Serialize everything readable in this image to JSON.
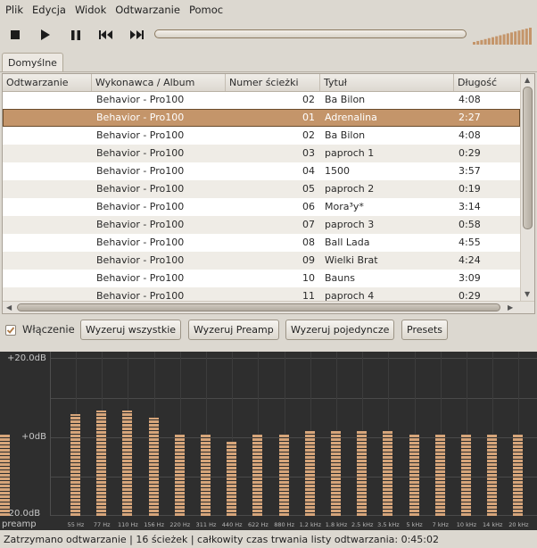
{
  "menu": [
    "Plik",
    "Edycja",
    "Widok",
    "Odtwarzanie",
    "Pomoc"
  ],
  "toolbar": {
    "buttons": [
      "stop-icon",
      "play-icon",
      "pause-icon",
      "previous-icon",
      "next-icon"
    ],
    "seek_progress": 0.0,
    "volume_level": 1.0
  },
  "tabs": [
    {
      "label": "Domyślne"
    }
  ],
  "playlist": {
    "columns": [
      "Odtwarzanie",
      "Wykonawca / Album",
      "Numer ścieżki",
      "Tytuł",
      "Długość"
    ],
    "rows": [
      {
        "artist": "Behavior - Pro100",
        "track": "02",
        "title": "Ba Bilon",
        "length": "4:08"
      },
      {
        "artist": "Behavior - Pro100",
        "track": "01",
        "title": "Adrenalina",
        "length": "2:27"
      },
      {
        "artist": "Behavior - Pro100",
        "track": "02",
        "title": "Ba Bilon",
        "length": "4:08"
      },
      {
        "artist": "Behavior - Pro100",
        "track": "03",
        "title": "paproch 1",
        "length": "0:29"
      },
      {
        "artist": "Behavior - Pro100",
        "track": "04",
        "title": "1500",
        "length": "3:57"
      },
      {
        "artist": "Behavior - Pro100",
        "track": "05",
        "title": "paproch 2",
        "length": "0:19"
      },
      {
        "artist": "Behavior - Pro100",
        "track": "06",
        "title": "Mora³y*",
        "length": "3:14"
      },
      {
        "artist": "Behavior - Pro100",
        "track": "07",
        "title": "paproch 3",
        "length": "0:58"
      },
      {
        "artist": "Behavior - Pro100",
        "track": "08",
        "title": "Ball Lada",
        "length": "4:55"
      },
      {
        "artist": "Behavior - Pro100",
        "track": "09",
        "title": "Wielki Brat",
        "length": "4:24"
      },
      {
        "artist": "Behavior - Pro100",
        "track": "10",
        "title": "Bauns",
        "length": "3:09"
      },
      {
        "artist": "Behavior - Pro100",
        "track": "11",
        "title": "paproch 4",
        "length": "0:29"
      }
    ],
    "selected_index": 1
  },
  "equalizer": {
    "enable_label": "Włączenie",
    "enabled": true,
    "buttons": [
      "Wyzeruj wszystkie",
      "Wyzeruj Preamp",
      "Wyzeruj pojedyncze",
      "Presets"
    ],
    "scale_labels": [
      "+20.0dB",
      "+0dB",
      "-20.0dB"
    ],
    "preamp_label": "preamp",
    "band_labels": [
      "55 Hz",
      "77 Hz",
      "110 Hz",
      "156 Hz",
      "220 Hz",
      "311 Hz",
      "440 Hz",
      "622 Hz",
      "880 Hz",
      "1.2 kHz",
      "1.8 kHz",
      "2.5 kHz",
      "3.5 kHz",
      "5 kHz",
      "7 kHz",
      "10 kHz",
      "14 kHz",
      "20 kHz"
    ],
    "preamp_db": 0,
    "bands_db": [
      5,
      6,
      6,
      4,
      0,
      0,
      -2,
      0,
      0,
      1,
      1,
      1,
      1,
      0,
      0,
      0,
      0,
      0
    ],
    "accent_color": "#d6a57a"
  },
  "status": "Zatrzymano odtwarzanie | 16 ścieżek | całkowity czas trwania listy odtwarzania: 0:45:02"
}
